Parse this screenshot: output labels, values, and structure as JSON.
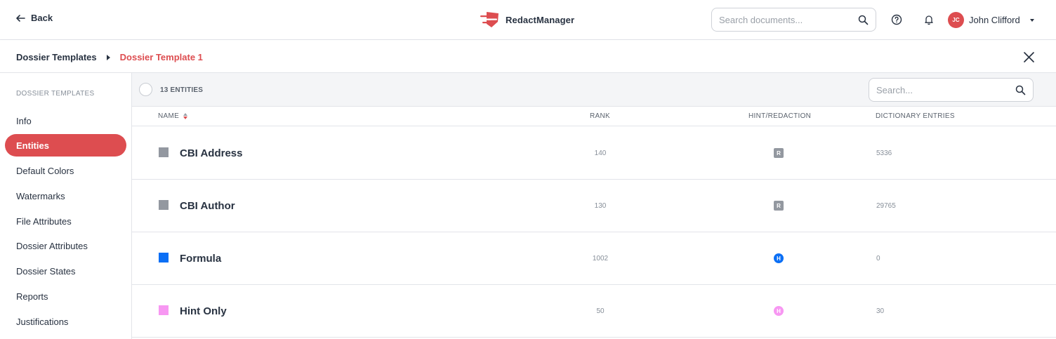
{
  "topbar": {
    "back_label": "Back",
    "app_name": "RedactManager",
    "search_placeholder": "Search documents...",
    "user": {
      "initials": "JC",
      "name": "John Clifford"
    }
  },
  "breadcrumb": {
    "parent": "Dossier Templates",
    "current": "Dossier Template 1"
  },
  "sidebar": {
    "title": "DOSSIER TEMPLATES",
    "items": [
      {
        "label": "Info",
        "active": false
      },
      {
        "label": "Entities",
        "active": true
      },
      {
        "label": "Default Colors",
        "active": false
      },
      {
        "label": "Watermarks",
        "active": false
      },
      {
        "label": "File Attributes",
        "active": false
      },
      {
        "label": "Dossier Attributes",
        "active": false
      },
      {
        "label": "Dossier States",
        "active": false
      },
      {
        "label": "Reports",
        "active": false
      },
      {
        "label": "Justifications",
        "active": false
      }
    ]
  },
  "list": {
    "count_label": "13 ENTITIES",
    "search_placeholder": "Search...",
    "columns": {
      "name": "NAME",
      "rank": "RANK",
      "hint_redaction": "HINT/REDACTION",
      "dictionary_entries": "DICTIONARY ENTRIES"
    },
    "rows": [
      {
        "name": "CBI Address",
        "color": "#9398a0",
        "rank": "140",
        "type": "R",
        "type_shape": "square",
        "entries": "5336"
      },
      {
        "name": "CBI Author",
        "color": "#9398a0",
        "rank": "130",
        "type": "R",
        "type_shape": "square",
        "entries": "29765"
      },
      {
        "name": "Formula",
        "color": "#0b6ff5",
        "rank": "1002",
        "type": "H",
        "type_shape": "circle",
        "entries": "0"
      },
      {
        "name": "Hint Only",
        "color": "#f797f2",
        "rank": "50",
        "type": "H",
        "type_shape": "circle",
        "entries": "30"
      }
    ]
  },
  "colors": {
    "accent": "#dd4d50",
    "text": "#283241",
    "muted": "#868e98"
  },
  "icons": [
    "arrow-left-icon",
    "logo-icon",
    "search-icon",
    "help-icon",
    "bell-icon",
    "chevron-down-icon",
    "close-icon",
    "sort-icon"
  ]
}
